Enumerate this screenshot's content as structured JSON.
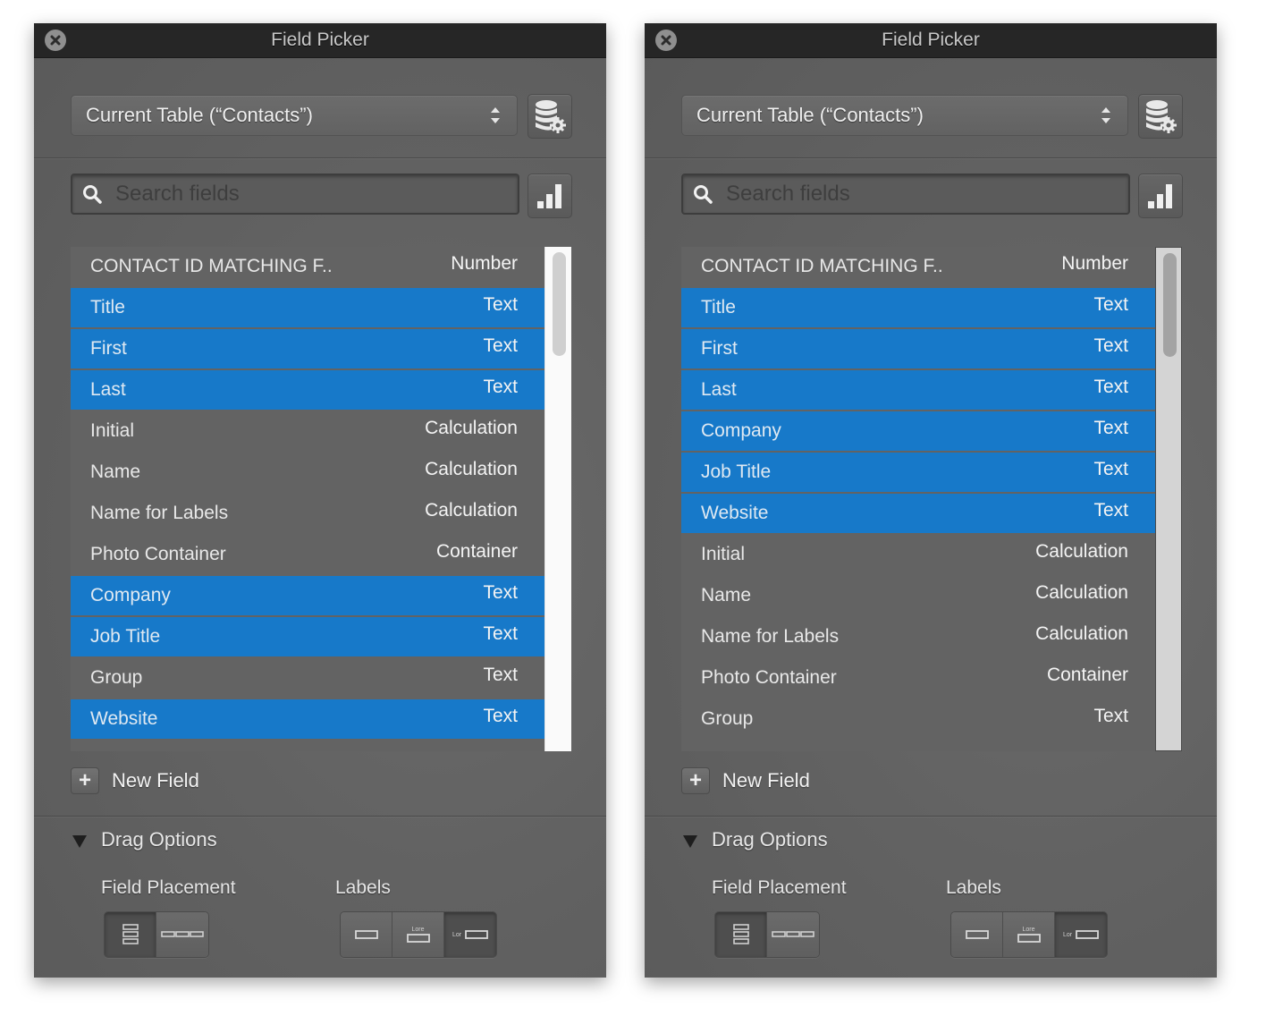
{
  "panels": [
    {
      "title": "Field Picker",
      "table_select": {
        "value": "Current Table (“Contacts”)"
      },
      "search": {
        "placeholder": "Search fields",
        "value": ""
      },
      "fields": [
        {
          "name": "CONTACT ID MATCHING F..",
          "type": "Number",
          "selected": false
        },
        {
          "name": "Title",
          "type": "Text",
          "selected": true
        },
        {
          "name": "First",
          "type": "Text",
          "selected": true
        },
        {
          "name": "Last",
          "type": "Text",
          "selected": true
        },
        {
          "name": "Initial",
          "type": "Calculation",
          "selected": false
        },
        {
          "name": "Name",
          "type": "Calculation",
          "selected": false
        },
        {
          "name": "Name for Labels",
          "type": "Calculation",
          "selected": false
        },
        {
          "name": "Photo Container",
          "type": "Container",
          "selected": false
        },
        {
          "name": "Company",
          "type": "Text",
          "selected": true
        },
        {
          "name": "Job Title",
          "type": "Text",
          "selected": true
        },
        {
          "name": "Group",
          "type": "Text",
          "selected": false
        },
        {
          "name": "Website",
          "type": "Text",
          "selected": true
        }
      ],
      "new_field_label": "New Field",
      "drag_options": {
        "label": "Drag Options",
        "field_placement_label": "Field Placement",
        "labels_label": "Labels",
        "field_placement_options": [
          "vertical",
          "horizontal"
        ],
        "field_placement_selected": "vertical",
        "label_options": [
          "none",
          "top",
          "left"
        ],
        "label_option_text": {
          "top": "Lore",
          "left": "Lor"
        },
        "labels_selected": "left"
      }
    },
    {
      "title": "Field Picker",
      "table_select": {
        "value": "Current Table (“Contacts”)"
      },
      "search": {
        "placeholder": "Search fields",
        "value": ""
      },
      "fields": [
        {
          "name": "CONTACT ID MATCHING F..",
          "type": "Number",
          "selected": false
        },
        {
          "name": "Title",
          "type": "Text",
          "selected": true
        },
        {
          "name": "First",
          "type": "Text",
          "selected": true
        },
        {
          "name": "Last",
          "type": "Text",
          "selected": true
        },
        {
          "name": "Company",
          "type": "Text",
          "selected": true
        },
        {
          "name": "Job Title",
          "type": "Text",
          "selected": true
        },
        {
          "name": "Website",
          "type": "Text",
          "selected": true
        },
        {
          "name": "Initial",
          "type": "Calculation",
          "selected": false
        },
        {
          "name": "Name",
          "type": "Calculation",
          "selected": false
        },
        {
          "name": "Name for Labels",
          "type": "Calculation",
          "selected": false
        },
        {
          "name": "Photo Container",
          "type": "Container",
          "selected": false
        },
        {
          "name": "Group",
          "type": "Text",
          "selected": false
        }
      ],
      "new_field_label": "New Field",
      "drag_options": {
        "label": "Drag Options",
        "field_placement_label": "Field Placement",
        "labels_label": "Labels",
        "field_placement_options": [
          "vertical",
          "horizontal"
        ],
        "field_placement_selected": "vertical",
        "label_options": [
          "none",
          "top",
          "left"
        ],
        "label_option_text": {
          "top": "Lore",
          "left": "Lor"
        },
        "labels_selected": "left"
      }
    }
  ],
  "colors": {
    "selection": "#1779c9",
    "titlebar": "#262626",
    "panel": "#636363"
  },
  "icons": {
    "close": "close-icon",
    "stepper": "up-down-chevron-icon",
    "database": "database-gear-icon",
    "chart": "bar-chart-icon",
    "search": "search-icon",
    "plus": "plus-icon",
    "disclosure": "disclosure-triangle-icon"
  }
}
